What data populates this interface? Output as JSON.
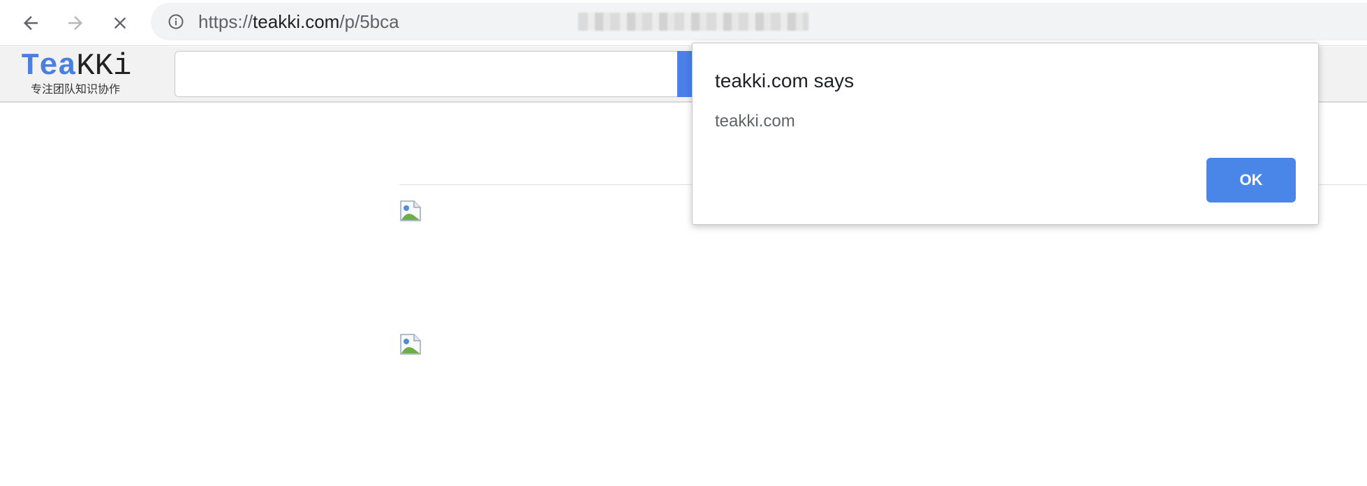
{
  "browser": {
    "url_scheme": "https://",
    "url_host": "teakki.com",
    "url_path": "/p/5bca",
    "icons": {
      "back": "back-arrow-icon",
      "forward": "forward-arrow-icon",
      "stop": "close-icon",
      "info": "info-icon"
    }
  },
  "site": {
    "logo_part1": "Tea",
    "logo_part2": "KKi",
    "slogan": "专注团队知识协作",
    "search_value": "",
    "colors": {
      "logo_accent": "#4a7fe0",
      "search_button": "#4a80e8"
    }
  },
  "content": {
    "broken_images": [
      {
        "icon": "broken-image-icon"
      },
      {
        "icon": "broken-image-icon"
      }
    ]
  },
  "dialog": {
    "title": "teakki.com says",
    "message": "teakki.com",
    "ok_label": "OK",
    "ok_color": "#4a86e8"
  }
}
